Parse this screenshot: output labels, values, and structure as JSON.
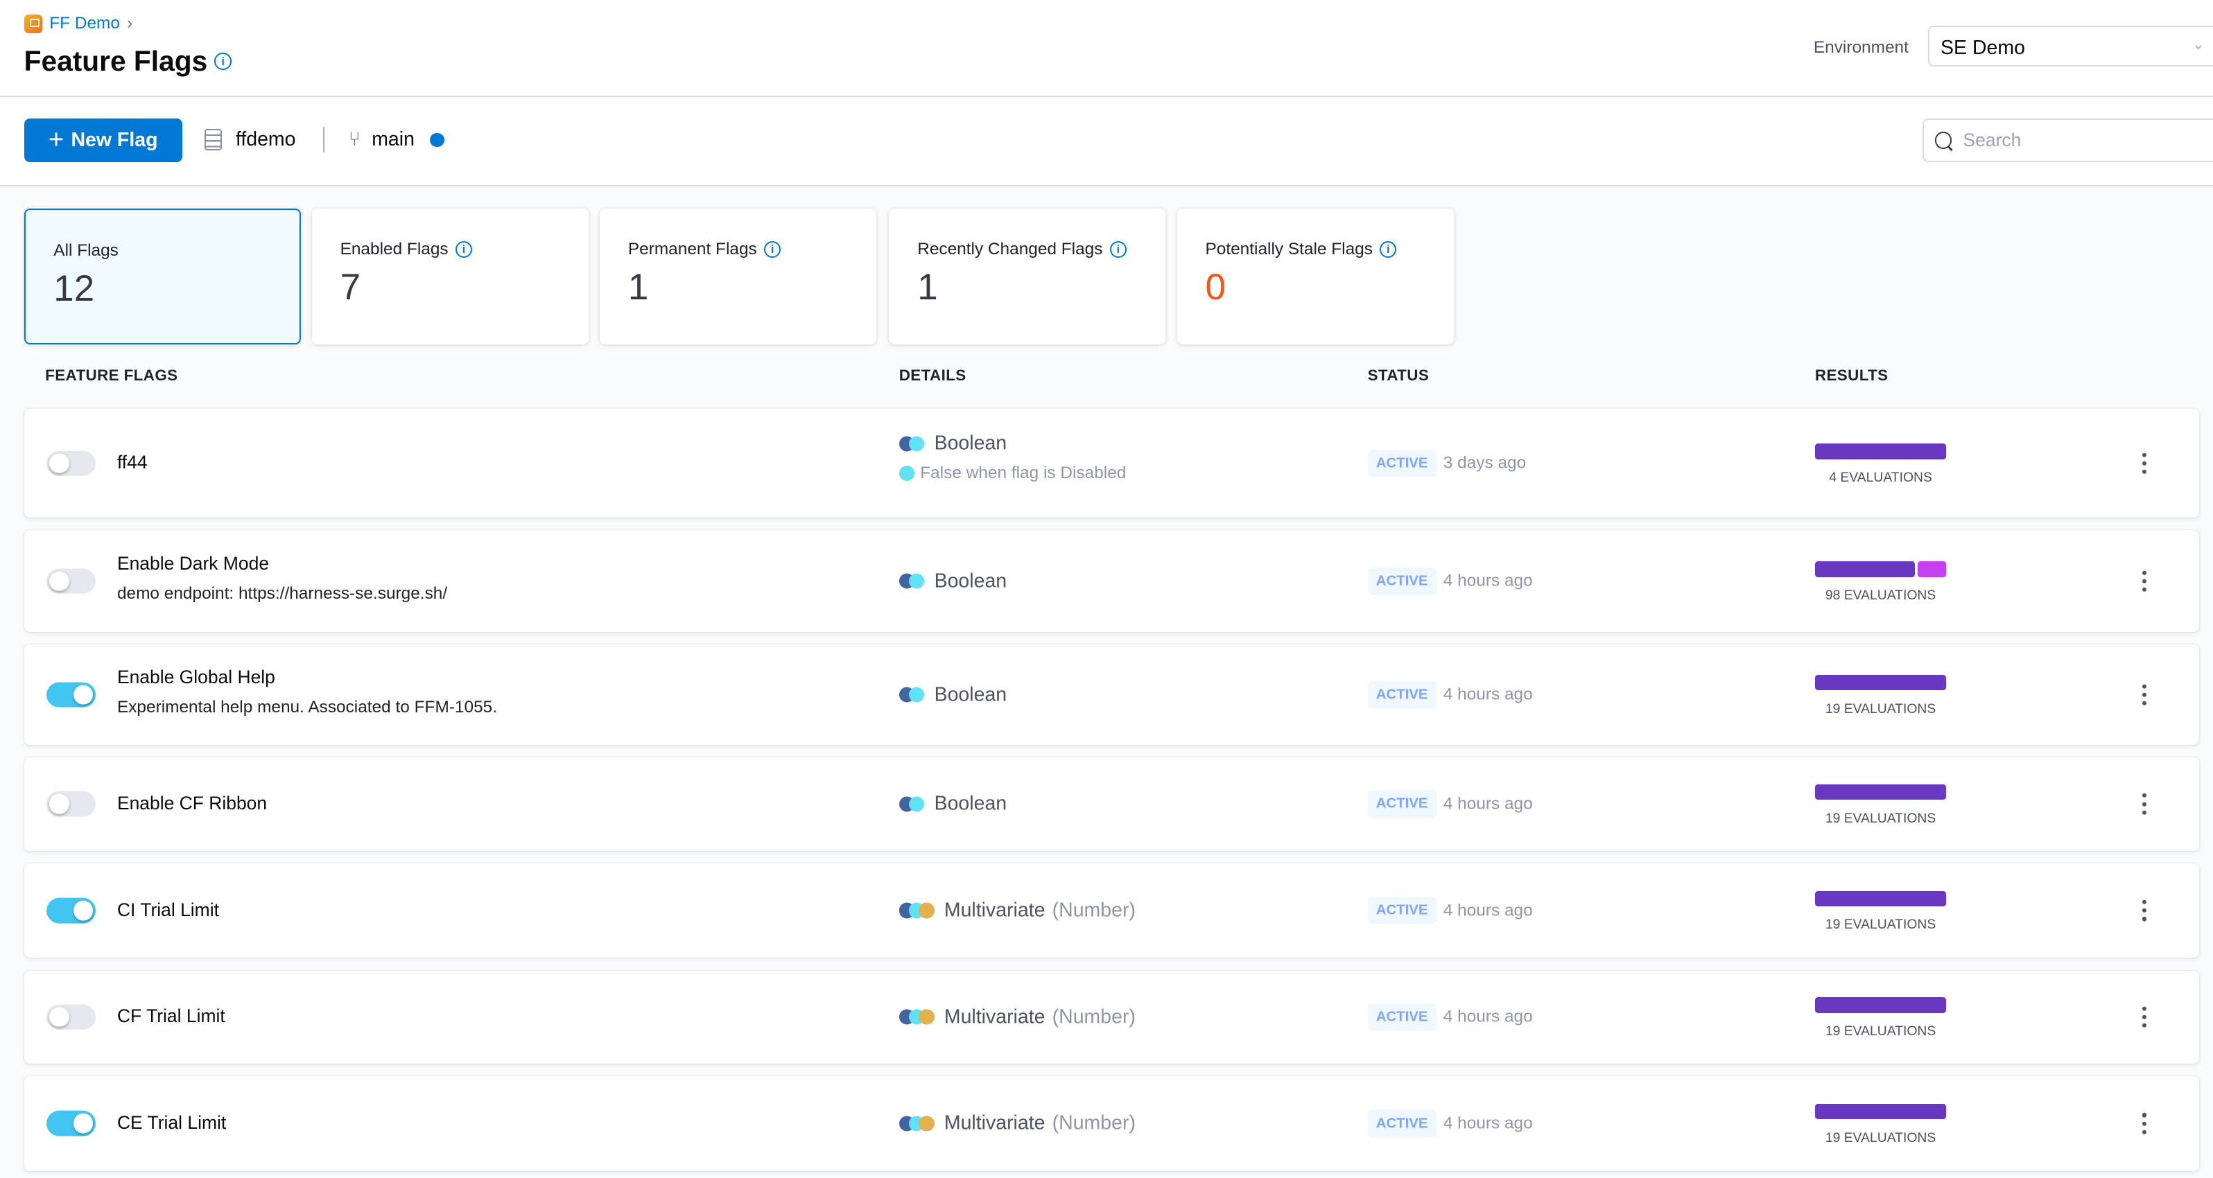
{
  "header": {
    "breadcrumb": "FF Demo",
    "title": "Feature Flags",
    "environment_label": "Environment",
    "environment_value": "SE Demo"
  },
  "toolbar": {
    "new_flag_label": "New Flag",
    "repo": "ffdemo",
    "branch": "main",
    "search_placeholder": "Search"
  },
  "summary_cards": [
    {
      "label": "All Flags",
      "value": "12",
      "selected": true
    },
    {
      "label": "Enabled Flags",
      "value": "7"
    },
    {
      "label": "Permanent Flags",
      "value": "1"
    },
    {
      "label": "Recently Changed Flags",
      "value": "1"
    },
    {
      "label": "Potentially Stale Flags",
      "value": "0"
    }
  ],
  "columns": [
    "FEATURE FLAGS",
    "DETAILS",
    "STATUS",
    "RESULTS"
  ],
  "colors": {
    "accent": "#0278d5",
    "toggle_on": "#42c6f1",
    "bar_primary": "#6938c0",
    "bar_secondary": "#c440f0",
    "variation_1": "#4164a3",
    "variation_2": "#61e2f4",
    "variation_3": "#e3b04e",
    "stale": "#ff5310"
  },
  "flags": [
    {
      "name": "ff44",
      "description": "",
      "enabled": false,
      "type": "Boolean",
      "subtype": "",
      "note": "False when flag is Disabled",
      "status": "ACTIVE",
      "changed": "3 days ago",
      "evaluations": "4 EVALUATIONS",
      "bar_split": [
        1.0
      ]
    },
    {
      "name": "Enable Dark Mode",
      "description": "demo endpoint: https://harness-se.surge.sh/",
      "enabled": false,
      "type": "Boolean",
      "subtype": "",
      "status": "ACTIVE",
      "changed": "4 hours ago",
      "evaluations": "98 EVALUATIONS",
      "bar_split": [
        0.77,
        0.23
      ]
    },
    {
      "name": "Enable Global Help",
      "description": "Experimental help menu. Associated to FFM-1055.",
      "enabled": true,
      "type": "Boolean",
      "subtype": "",
      "status": "ACTIVE",
      "changed": "4 hours ago",
      "evaluations": "19 EVALUATIONS",
      "bar_split": [
        1.0
      ]
    },
    {
      "name": "Enable CF Ribbon",
      "description": "",
      "enabled": false,
      "type": "Boolean",
      "subtype": "",
      "status": "ACTIVE",
      "changed": "4 hours ago",
      "evaluations": "19 EVALUATIONS",
      "bar_split": [
        1.0
      ]
    },
    {
      "name": "CI Trial Limit",
      "description": "",
      "enabled": true,
      "type": "Multivariate",
      "subtype": "(Number)",
      "status": "ACTIVE",
      "changed": "4 hours ago",
      "evaluations": "19 EVALUATIONS",
      "bar_split": [
        1.0
      ]
    },
    {
      "name": "CF Trial Limit",
      "description": "",
      "enabled": false,
      "type": "Multivariate",
      "subtype": "(Number)",
      "status": "ACTIVE",
      "changed": "4 hours ago",
      "evaluations": "19 EVALUATIONS",
      "bar_split": [
        1.0
      ]
    },
    {
      "name": "CE Trial Limit",
      "description": "",
      "enabled": true,
      "type": "Multivariate",
      "subtype": "(Number)",
      "status": "ACTIVE",
      "changed": "4 hours ago",
      "evaluations": "19 EVALUATIONS",
      "bar_split": [
        1.0
      ]
    }
  ]
}
